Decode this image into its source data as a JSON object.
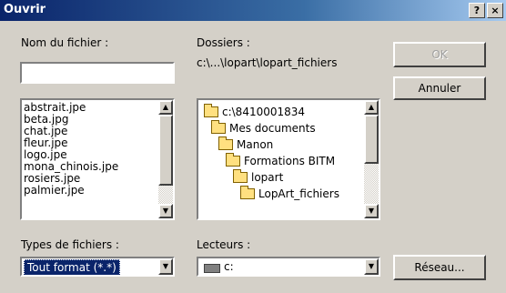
{
  "window": {
    "title": "Ouvrir",
    "help_label": "?",
    "close_label": "×"
  },
  "filename": {
    "label": "Nom du fichier :",
    "value": "",
    "files": [
      "abstrait.jpe",
      "beta.jpg",
      "chat.jpe",
      "fleur.jpe",
      "logo.jpe",
      "mona_chinois.jpe",
      "rosiers.jpe",
      "palmier.jpe"
    ]
  },
  "folders": {
    "label": "Dossiers :",
    "path": "c:\\...\\lopart\\lopart_fichiers",
    "items": [
      "c:\\8410001834",
      "Mes documents",
      "Manon",
      "Formations BITM",
      "lopart",
      "LopArt_fichiers"
    ]
  },
  "buttons": {
    "ok": "OK",
    "cancel": "Annuler",
    "network": "Réseau..."
  },
  "file_types": {
    "label": "Types de fichiers :",
    "value": "Tout format (*.*)"
  },
  "drives": {
    "label": "Lecteurs :",
    "value": "c:"
  }
}
